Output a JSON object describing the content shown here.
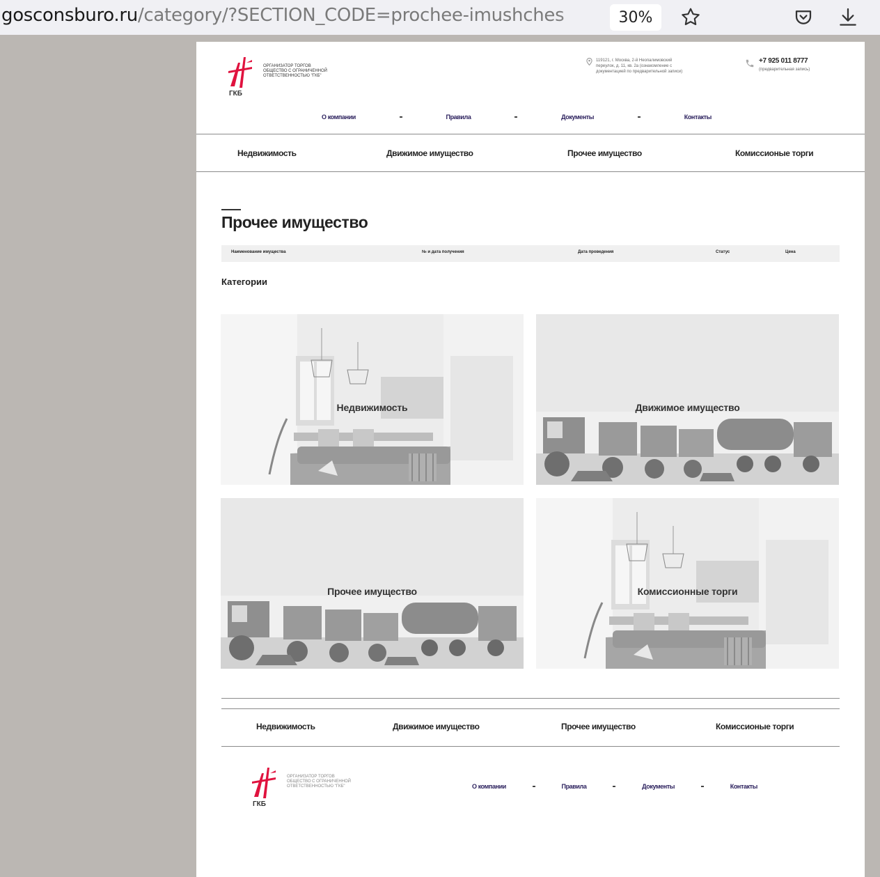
{
  "browser": {
    "url_host": "gosconsburo.ru",
    "url_path": "/category/?SECTION_CODE=prochee-imushches",
    "zoom": "30%",
    "icons": [
      "bookmark-star-icon",
      "pocket-icon",
      "download-icon"
    ]
  },
  "header": {
    "logo": {
      "mark_text": "ГКБ",
      "tagline_lines": [
        "ОРГАНИЗАТОР ТОРГОВ",
        "ОБЩЕСТВО С ОГРАНИЧЕННОЙ",
        "ОТВЕТСТВЕННОСТЬЮ \"ГКБ\""
      ]
    },
    "address_lines": [
      "119121, г. Москва, 2-й Неопалимовский",
      "переулок, д. 11, кв. 2а (ознакомление с",
      "документацией по предварительной записи)"
    ],
    "phone": "+7 925 011 8777",
    "phone_note": "(предварительная запись)",
    "nav": [
      "О компании",
      "Правила",
      "Документы",
      "Контакты"
    ]
  },
  "category_nav": [
    "Недвижимость",
    "Движимое имущество",
    "Прочее имущество",
    "Комиссионые торги"
  ],
  "main": {
    "title": "Прочее имущество",
    "table_headers": [
      "Наименование имущества",
      "№ и дата получения",
      "Дата проведения",
      "Статус",
      "Цена"
    ],
    "categories_label": "Категории",
    "cards": [
      {
        "label": "Недвижимость",
        "image": "interior"
      },
      {
        "label": "Движимое имущество",
        "image": "vehicles"
      },
      {
        "label": "Прочее имущество",
        "image": "vehicles"
      },
      {
        "label": "Комиссионные торги",
        "image": "interior"
      }
    ]
  },
  "footer": {
    "category_nav": [
      "Недвижимость",
      "Движимое имущество",
      "Прочее имущество",
      "Комиссионые торги"
    ],
    "logo": {
      "mark_text": "ГКБ",
      "tagline_lines": [
        "ОРГАНИЗАТОР ТОРГОВ",
        "ОБЩЕСТВО С ОГРАНИЧЕННОЙ",
        "ОТВЕТСТВЕННОСТЬЮ \"ГКБ\""
      ]
    },
    "nav": [
      "О компании",
      "Правила",
      "Документы",
      "Контакты"
    ]
  },
  "colors": {
    "logo_red": "#e0123e",
    "nav_navy": "#2a1f5c",
    "backdrop": "#bbb7b3"
  }
}
